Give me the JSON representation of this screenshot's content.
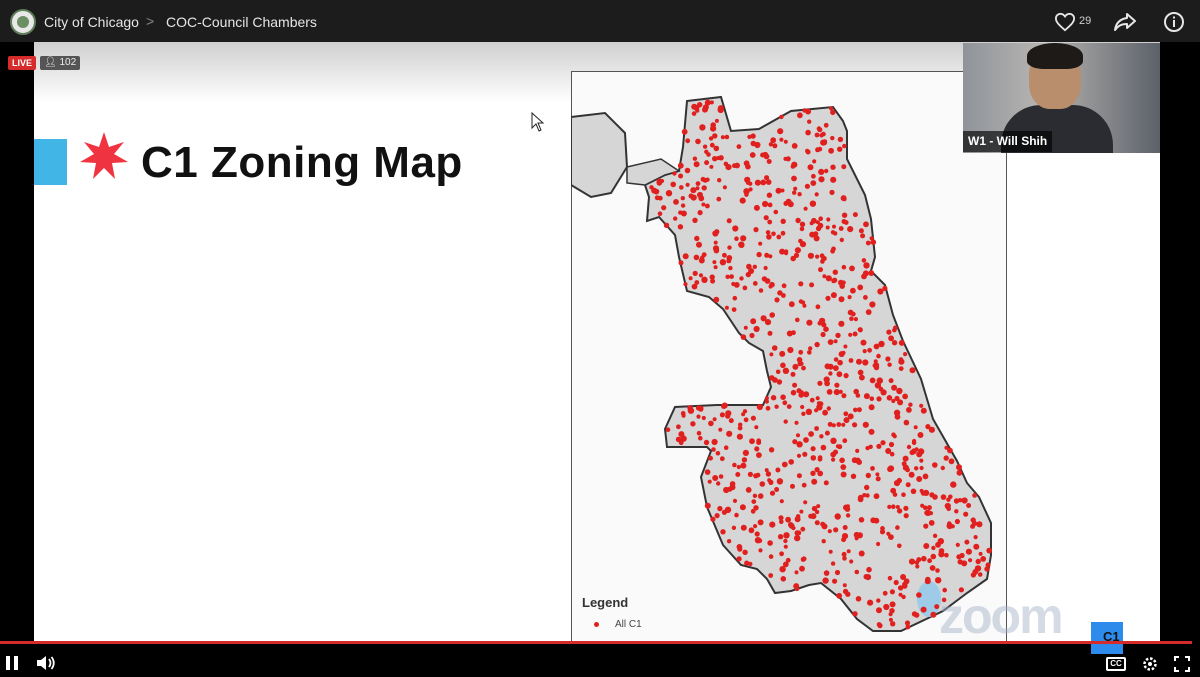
{
  "header": {
    "crumbs": [
      "City of Chicago",
      "COC-Council Chambers"
    ],
    "separator": ">",
    "likes": "29"
  },
  "stream": {
    "live_label": "LIVE",
    "viewer_count": "102"
  },
  "slide": {
    "title": "C1 Zoning Map",
    "legend_title": "Legend",
    "legend_item": "All C1",
    "watermark": "zoom",
    "corner_label": "C1"
  },
  "participant": {
    "label": "W1 - Will Shih"
  },
  "controls": {
    "cc_label": "CC"
  },
  "colors": {
    "live": "#d52b2b",
    "flag_blue": "#41b6e6",
    "flag_star": "#ef3340",
    "dot": "#e0201e"
  },
  "icons": [
    "city-seal-icon",
    "heart-icon",
    "share-icon",
    "info-icon",
    "star-icon",
    "cursor-icon",
    "person-icon",
    "pause-icon",
    "volume-icon",
    "cc-icon",
    "settings-icon",
    "fullscreen-icon"
  ]
}
